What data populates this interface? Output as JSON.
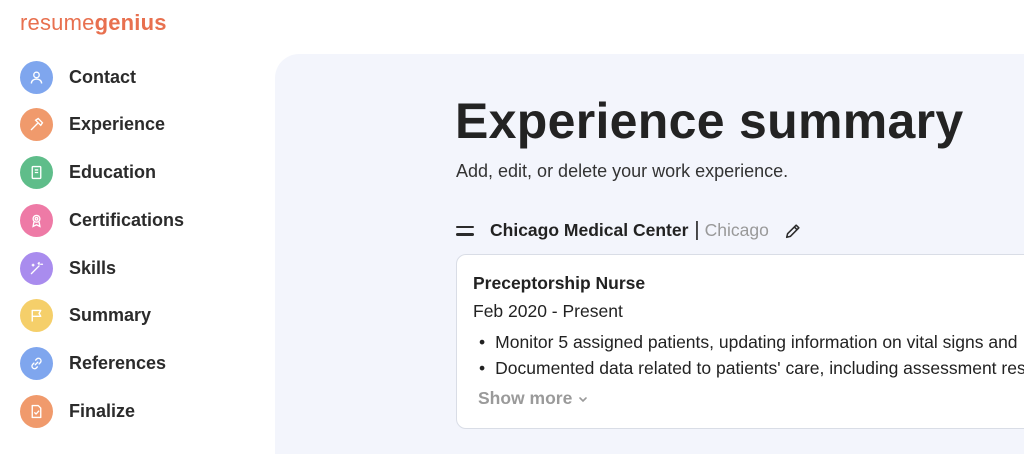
{
  "brand": {
    "logo_part1": "resume",
    "logo_part2": "genius",
    "color": "#e8704f"
  },
  "sidebar": {
    "items": [
      {
        "label": "Contact",
        "icon": "person-icon",
        "color": "#7fa6ee"
      },
      {
        "label": "Experience",
        "icon": "hammer-icon",
        "color": "#f09a6c"
      },
      {
        "label": "Education",
        "icon": "book-icon",
        "color": "#5fbd8a"
      },
      {
        "label": "Certifications",
        "icon": "award-icon",
        "color": "#ee7aa6"
      },
      {
        "label": "Skills",
        "icon": "magic-wand-icon",
        "color": "#a98cee"
      },
      {
        "label": "Summary",
        "icon": "flag-icon",
        "color": "#f5cf6a"
      },
      {
        "label": "References",
        "icon": "link-icon",
        "color": "#7fa6ee"
      },
      {
        "label": "Finalize",
        "icon": "document-check-icon",
        "color": "#f09a6c"
      }
    ]
  },
  "main": {
    "title": "Experience summary",
    "subtitle": "Add, edit, or delete your work experience.",
    "entry": {
      "employer": "Chicago Medical Center",
      "separator": "|",
      "city": "Chicago",
      "job_title": "Preceptorship Nurse",
      "dates": "Feb 2020 - Present",
      "bullets": [
        "Monitor 5 assigned patients, updating information on vital signs and",
        "Documented data related to patients' care, including assessment res"
      ],
      "show_more": "Show more"
    }
  }
}
